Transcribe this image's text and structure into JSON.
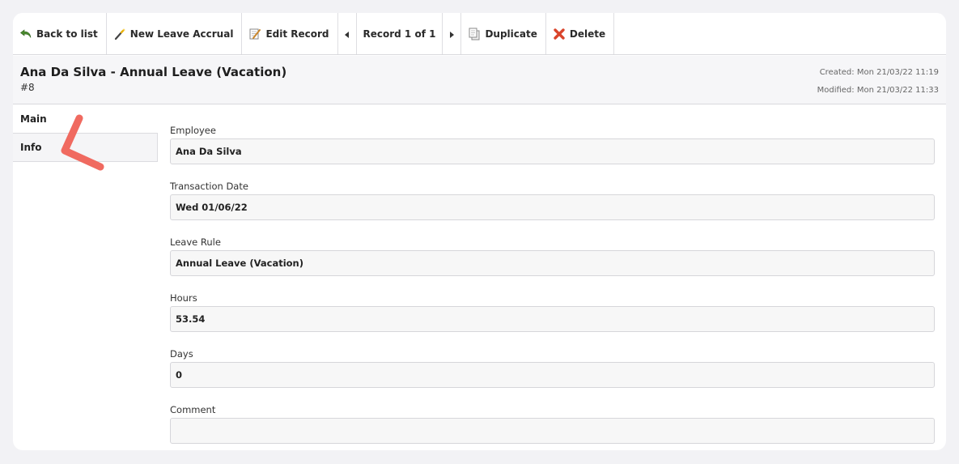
{
  "toolbar": {
    "back_label": "Back to list",
    "new_label": "New Leave Accrual",
    "edit_label": "Edit Record",
    "record_label": "Record 1 of 1",
    "duplicate_label": "Duplicate",
    "delete_label": "Delete"
  },
  "header": {
    "title": "Ana Da Silva - Annual Leave (Vacation)",
    "record_id": "#8",
    "created": "Created: Mon 21/03/22 11:19",
    "modified": "Modified: Mon 21/03/22 11:33"
  },
  "sidebar": {
    "items": [
      {
        "label": "Main"
      },
      {
        "label": "Info"
      }
    ]
  },
  "form": {
    "fields": [
      {
        "label": "Employee",
        "value": "Ana Da Silva"
      },
      {
        "label": "Transaction Date",
        "value": "Wed 01/06/22"
      },
      {
        "label": "Leave Rule",
        "value": "Annual Leave (Vacation)"
      },
      {
        "label": "Hours",
        "value": "53.54"
      },
      {
        "label": "Days",
        "value": "0"
      },
      {
        "label": "Comment",
        "value": ""
      }
    ]
  },
  "icons": {
    "back": "undo-arrow-icon",
    "new": "magic-wand-icon",
    "edit": "edit-document-icon",
    "prev": "triangle-left-icon",
    "next": "triangle-right-icon",
    "duplicate": "copy-document-icon",
    "delete": "red-x-icon"
  },
  "colors": {
    "annotation": "#f06a60",
    "delete_icon": "#d9442b",
    "back_icon": "#4a8a2e"
  }
}
